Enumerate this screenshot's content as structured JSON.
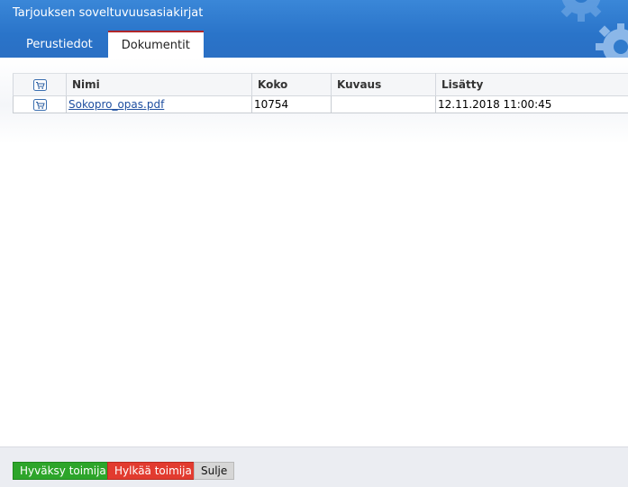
{
  "window": {
    "title": "Tarjouksen soveltuvuusasiakirjat"
  },
  "tabs": [
    {
      "label": "Perustiedot",
      "active": false
    },
    {
      "label": "Dokumentit",
      "active": true
    }
  ],
  "table": {
    "columns": [
      "",
      "Nimi",
      "Koko",
      "Kuvaus",
      "Lisätty"
    ],
    "rows": [
      {
        "name": "Sokopro_opas.pdf",
        "size": "10754",
        "description": "",
        "added": "12.11.2018 11:00:45"
      }
    ]
  },
  "footer": {
    "accept_label": "Hyväksy toimija",
    "reject_label": "Hylkää toimija",
    "close_label": "Sulje"
  },
  "colors": {
    "header_blue": "#2a74c9",
    "accept_green": "#2da52a",
    "reject_red": "#e23b2f",
    "tab_accent": "#b0272a"
  },
  "icons": {
    "column_header_icon": "cart-icon",
    "row_icon": "cart-icon",
    "header_decor": "gear-icon"
  }
}
